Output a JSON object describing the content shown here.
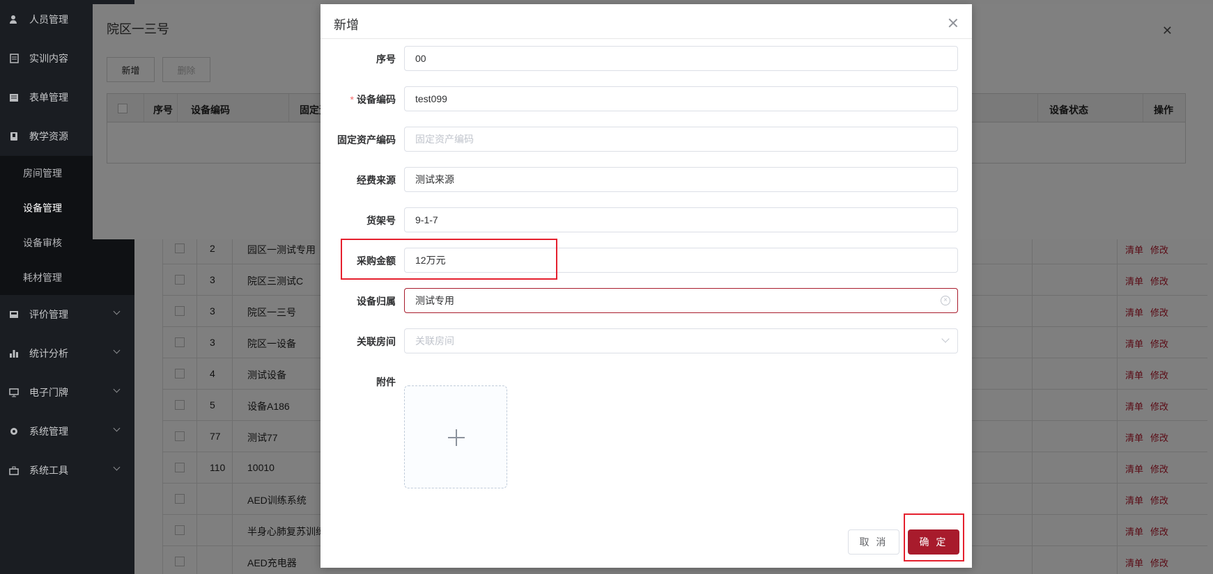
{
  "sidebar": {
    "items": [
      {
        "label": "人员管理",
        "icon": "user-icon"
      },
      {
        "label": "实训内容",
        "icon": "document-icon"
      },
      {
        "label": "表单管理",
        "icon": "form-icon"
      },
      {
        "label": "教学资源",
        "icon": "book-icon"
      },
      {
        "label": "评价管理",
        "icon": "review-icon"
      },
      {
        "label": "统计分析",
        "icon": "bar-chart-icon"
      },
      {
        "label": "电子门牌",
        "icon": "monitor-icon"
      },
      {
        "label": "系统管理",
        "icon": "gear-icon"
      },
      {
        "label": "系统工具",
        "icon": "toolbox-icon"
      }
    ],
    "sub_items": [
      {
        "label": "房间管理"
      },
      {
        "label": "设备管理"
      },
      {
        "label": "设备审核"
      },
      {
        "label": "耗材管理"
      }
    ]
  },
  "middle_dialog": {
    "title": "院区一三号",
    "add_label": "新增",
    "delete_label": "删除",
    "columns": [
      "序号",
      "设备编码",
      "固定资",
      "设备状态",
      "操作"
    ]
  },
  "background_rows": [
    {
      "no": "2",
      "name": "园区一测试专用"
    },
    {
      "no": "3",
      "name": "院区三测试C"
    },
    {
      "no": "3",
      "name": "院区一三号"
    },
    {
      "no": "3",
      "name": "院区一设备"
    },
    {
      "no": "4",
      "name": "测试设备"
    },
    {
      "no": "5",
      "name": "设备A186"
    },
    {
      "no": "77",
      "name": "测试77"
    },
    {
      "no": "110",
      "name": "10010"
    },
    {
      "no": "",
      "name": "AED训练系统"
    },
    {
      "no": "",
      "name": "半身心肺复苏训练"
    },
    {
      "no": "",
      "name": "AED充电器"
    }
  ],
  "row_actions": {
    "list": "清单",
    "edit": "修改"
  },
  "dialog": {
    "title": "新增",
    "fields": {
      "serial": {
        "label": "序号",
        "value": "00"
      },
      "device_code": {
        "label": "设备编码",
        "value": "test099",
        "required_mark": "*"
      },
      "asset_code": {
        "label": "固定资产编码",
        "value": "",
        "placeholder": "固定资产编码"
      },
      "funding_source": {
        "label": "经费来源",
        "value": "测试来源"
      },
      "shelf_no": {
        "label": "货架号",
        "value": "9-1-7"
      },
      "purchase_amount": {
        "label": "采购金额",
        "value": "12万元"
      },
      "ownership": {
        "label": "设备归属",
        "value": "测试专用"
      },
      "room": {
        "label": "关联房间",
        "value": "",
        "placeholder": "关联房间"
      },
      "attachment": {
        "label": "附件"
      }
    },
    "cancel_label": "取 消",
    "ok_label": "确 定"
  },
  "colors": {
    "accent": "#a81b2c",
    "highlight": "#e5202e",
    "sidebar_bg": "#1a1d22"
  }
}
